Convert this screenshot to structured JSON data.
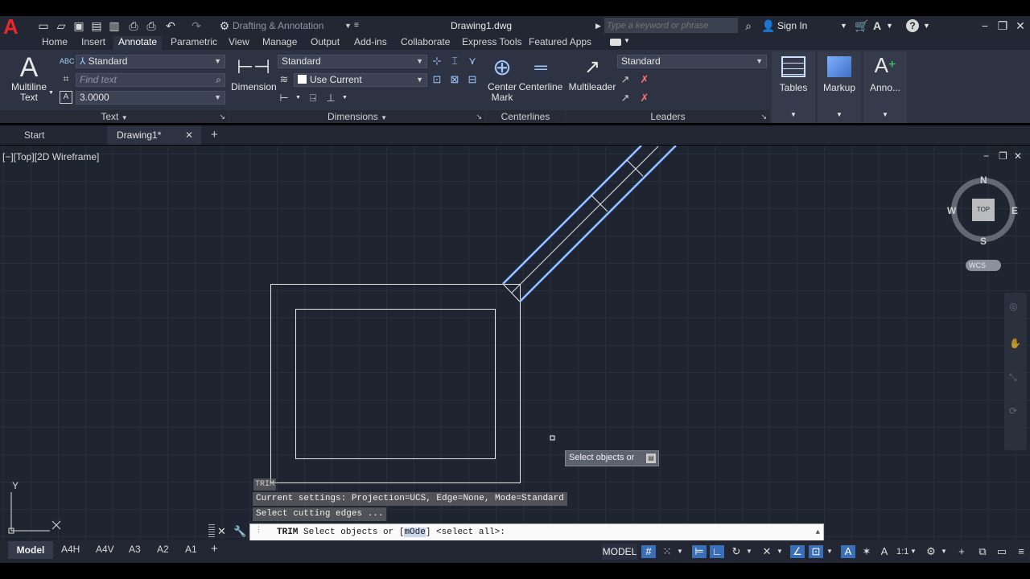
{
  "app": {
    "workspace": "Drafting & Annotation",
    "file_title": "Drawing1.dwg",
    "search_placeholder": "Type a keyword or phrase",
    "sign_in": "Sign In"
  },
  "ribbon_tabs": [
    "Home",
    "Insert",
    "Annotate",
    "Parametric",
    "View",
    "Manage",
    "Output",
    "Add-ins",
    "Collaborate",
    "Express Tools",
    "Featured Apps"
  ],
  "ribbon": {
    "text_panel": {
      "multiline_text_line1": "Multiline",
      "multiline_text_line2": "Text",
      "style": "Standard",
      "find_placeholder": "Find text",
      "height": "3.0000",
      "title": "Text"
    },
    "dimensions_panel": {
      "dimension_label": "Dimension",
      "style": "Standard",
      "layer": "Use Current",
      "title": "Dimensions"
    },
    "centerlines_panel": {
      "center_mark_line1": "Center",
      "center_mark_line2": "Mark",
      "centerline": "Centerline",
      "title": "Centerlines"
    },
    "leaders_panel": {
      "multileader": "Multileader",
      "style": "Standard",
      "title": "Leaders"
    },
    "tables": "Tables",
    "markup": "Markup",
    "anno": "Anno..."
  },
  "doc_tabs": {
    "start": "Start",
    "drawing": "Drawing1*"
  },
  "viewport": {
    "label": "[−][Top][2D Wireframe]",
    "compass": {
      "n": "N",
      "s": "S",
      "e": "E",
      "w": "W",
      "top": "TOP"
    },
    "wcs": "WCS",
    "ucs_y": "Y",
    "tooltip": "Select objects or"
  },
  "command": {
    "history": [
      "TRIM",
      "Current settings: Projection=UCS, Edge=None, Mode=Standard",
      "Select cutting edges ..."
    ],
    "prompt_cmd": "TRIM",
    "prompt_text1": "Select objects or [",
    "prompt_highlight": "mOde",
    "prompt_text2": "] <select all>:"
  },
  "layout_tabs": [
    "Model",
    "A4H",
    "A4V",
    "A3",
    "A2",
    "A1"
  ],
  "status": {
    "model": "MODEL",
    "scale": "1:1"
  },
  "colors": {
    "accent": "#3a6fb5",
    "selection_blue": "#4a8cff",
    "canvas": "#1f2530"
  }
}
